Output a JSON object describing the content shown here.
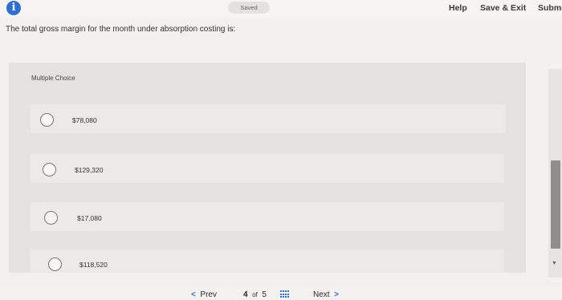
{
  "header": {
    "saved_label": "Saved",
    "help_label": "Help",
    "save_exit_label": "Save & Exit",
    "submit_label": "Submi"
  },
  "question": {
    "text": "The total gross margin for the month under absorption costing is:"
  },
  "panel": {
    "label": "Multiple Choice"
  },
  "options": [
    {
      "label": "$78,080"
    },
    {
      "label": "$129,320"
    },
    {
      "label": "$17,080"
    },
    {
      "label": "$118,520"
    }
  ],
  "footer": {
    "prev_label": "Prev",
    "page_current": "4",
    "page_of": "of",
    "page_total": "5",
    "next_label": "Next"
  },
  "colors": {
    "accent": "#2f6fd4",
    "background": "#f2f1ef",
    "panel": "#e4e3e1"
  }
}
